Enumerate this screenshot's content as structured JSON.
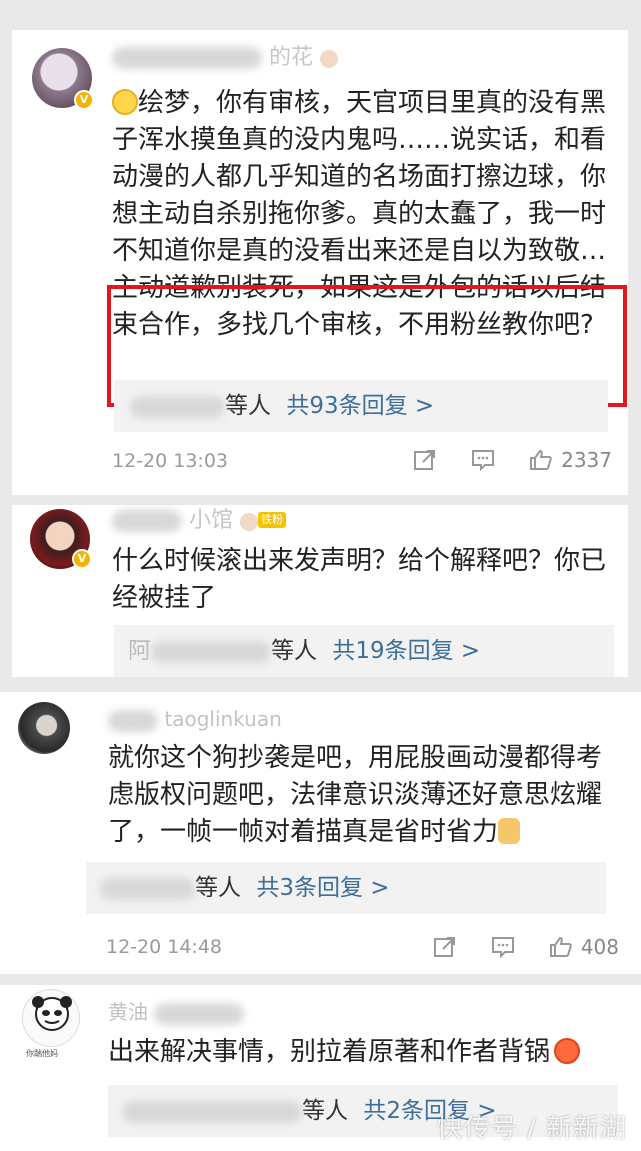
{
  "comments": [
    {
      "username": "的花",
      "text": "绘梦，你有审核，天官项目里真的没有黑子浑水摸鱼真的没内鬼吗……说实话，和看动漫的人都几乎知道的名场面打擦边球，你想主动自杀别拖你爹。真的太蠢了，我一时不知道你是真的没看出来还是自以为致敬…主动道歉别装死，如果这是外包的话以后结束合作，多找几个审核，不用粉丝教你吧?",
      "reply_user": "菩荠小馆",
      "reply_suffix": "等人",
      "reply_more": "共93条回复 >",
      "time": "12-20 13:03",
      "likes": "2337",
      "verified": "V"
    },
    {
      "username": "小馆",
      "fan_badge": "铁粉",
      "text": "什么时候滚出来发声明？给个解释吧？你已经被挂了",
      "reply_user": "阿",
      "reply_suffix": "等人",
      "reply_more": "共19条回复 >",
      "verified": "V"
    },
    {
      "username": "taoglinkuan",
      "text": "就你这个狗抄袭是吧，用屁股画动漫都得考虑版权问题吧，法律意识淡薄还好意思炫耀了，一帧一帧对着描真是省时省力",
      "reply_user": "",
      "reply_suffix": "等人",
      "reply_more": "共3条回复 >",
      "time": "12-20 14:48",
      "likes": "408"
    },
    {
      "username": "黄油",
      "text": "出来解决事情，别拉着原著和作者背锅",
      "reply_user": "",
      "reply_suffix": "等人",
      "reply_more": "共2条回复 >",
      "avatar_caption": "你踹他妈"
    }
  ],
  "watermark": "快传号 / 新新湖",
  "colors": {
    "highlight_border": "#e0171f",
    "link": "#3f6e9a",
    "verified": "#f4b300"
  }
}
